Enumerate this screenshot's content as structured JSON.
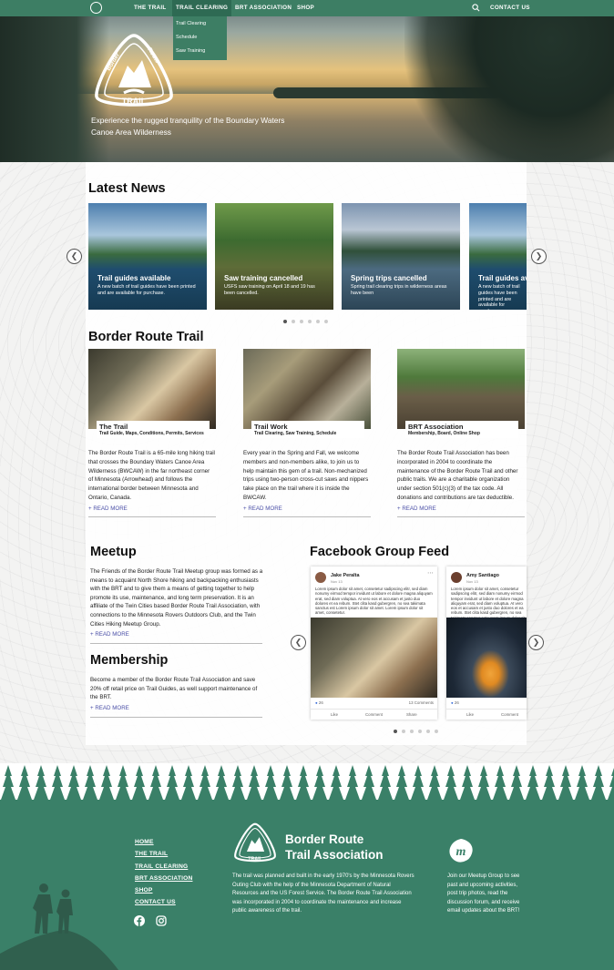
{
  "nav": {
    "items": [
      "THE TRAIL",
      "TRAIL CLEARING",
      "BRT ASSOCIATION",
      "SHOP"
    ],
    "contact": "CONTACT US",
    "dropdown": [
      "Trail Clearing",
      "Schedule",
      "Saw Training"
    ]
  },
  "hero": {
    "logo_text_top": "Border Route",
    "logo_text_bottom": "TRAIL",
    "tagline": "Experience the rugged tranquility of the Boundary Waters Canoe Area Wilderness"
  },
  "news": {
    "heading": "Latest News",
    "items": [
      {
        "title": "Trail guides available",
        "text": "A new batch of trail guides have been printed and are available for purchase."
      },
      {
        "title": "Saw training cancelled",
        "text": "USFS saw training on April 18 and 19 has been cancelled."
      },
      {
        "title": "Spring trips cancelled",
        "text": "Spring trail clearing trips in wilderness areas have been"
      },
      {
        "title": "Trail guides available",
        "text": "A new batch of trail guides have been printed and are available for purchase."
      }
    ]
  },
  "trail": {
    "heading": "Border Route Trail",
    "cards": [
      {
        "title": "The Trail",
        "subtitle": "Trail Guide, Maps, Conditions, Permits, Services",
        "body": "The Border Route Trail is a 65-mile long hiking trail that crosses the Boundary Waters Canoe Area Wilderness (BWCAW) in the far northeast corner of Minnesota (Arrowhead) and follows the international border between Minnesota and Ontario, Canada.",
        "link": "+ READ MORE"
      },
      {
        "title": "Trail Work",
        "subtitle": "Trail Clearing, Saw Training, Schedule",
        "body": "Every year in the Spring and Fall, we welcome members and non-members alike, to join us to help maintain this gem of a trail. Non-mechanized trips using two-person cross-cut saws and nippers take place on the trail where it is inside the BWCAW.",
        "link": "+ READ MORE"
      },
      {
        "title": "BRT Association",
        "subtitle": "Membership, Board, Online Shop",
        "body": "The Border Route Trail Association has been incorporated in 2004 to coordinate the maintenance of the Border Route Trail and other public trails. We are a charitable organization under section 501(c)(3) of the tax code. All donations and contributions are tax deductible.",
        "link": "+ READ MORE"
      }
    ]
  },
  "meetup": {
    "heading": "Meetup",
    "body": "The Friends of the Border Route Trail Meetup group was formed as a means to acquaint North Shore hiking and backpacking enthusiasts with the BRT and to give them a means of getting together to help promote its use, maintenance, and long term preservation. It is an affiliate of the Twin Cities based Border Route Trail Association, with connections to the Minnesota Rovers Outdoors Club, and the Twin Cities Hiking Meetup Group.",
    "link": "+ READ MORE"
  },
  "membership": {
    "heading": "Membership",
    "body": "Become a member of the Border Route Trail Association and save 20% off retail price on Trail Guides, as well support maintenance of the BRT.",
    "link": "+ READ MORE"
  },
  "facebook": {
    "heading": "Facebook Group Feed",
    "posts": [
      {
        "name": "Jake Peralta",
        "date": "Nov 13",
        "text": "Lorem ipsum dolor sit amet, consetetur sadipscing elitr, sed diam nonumy eirmod tempor invidunt ut labore et dolore magna aliquyam erat, sed diam voluptua. At vero eos et accusam et justo duo dolores et ea rebum. Stet clita kasd gubergren, no sea takimata sanctus est Lorem ipsum dolor sit amet. Lorem ipsum dolor sit amet, consetetur.",
        "likes": "26",
        "comments": "13 Comments",
        "like": "Like",
        "comment": "Comment",
        "share": "Share"
      },
      {
        "name": "Amy Santiago",
        "date": "Nov 13",
        "text": "Lorem ipsum dolor sit amet, consetetur sadipscing elitr, sed diam nonumy eirmod tempor invidunt ut labore et dolore magna aliquyam erat, sed diam voluptua. At vero eos et accusam et justo duo dolores et ea rebum. Stet clita kasd gubergren, no sea takimata sanctus est Lorem ipsum dolor sit amet.",
        "likes": "26",
        "like": "Like",
        "comment": "Comment"
      }
    ]
  },
  "footer": {
    "links": [
      "HOME",
      "THE TRAIL",
      "TRAIL CLEARING",
      "BRT ASSOCIATION",
      "SHOP",
      "CONTACT US"
    ],
    "title_line1": "Border Route",
    "title_line2": "Trail Association",
    "about": "The trail was planned and built in the early 1970's by the Minnesota Rovers Outing Club with the help of the Minnesota Department of Natural Resources and the US Forest Service. The Border Route Trail Association was incorporated in 2004 to coordinate the maintenance and increase public awareness of the trail.",
    "meetup_text": "Join our Meetup Group to see past and upcoming activities, post trip photos, read the discussion forum, and receive email updates about the BRT!"
  },
  "colors": {
    "brand_green": "#3d7e64",
    "link_blue": "#4a4fa7"
  }
}
